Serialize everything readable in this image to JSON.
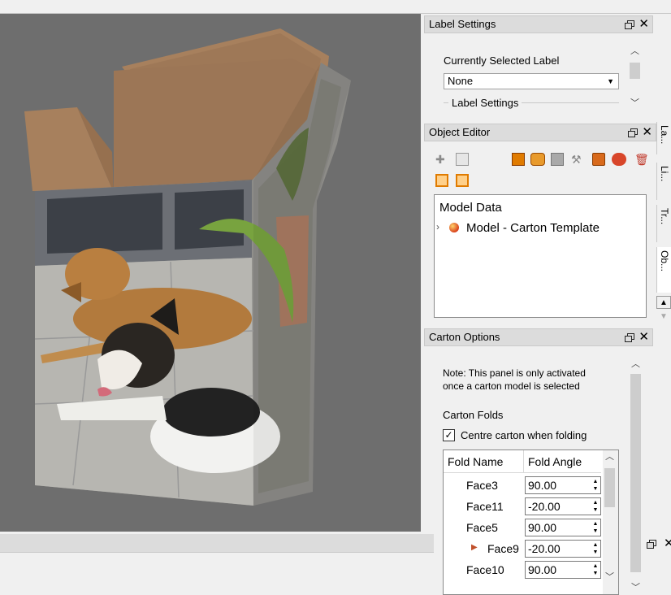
{
  "label_settings": {
    "title": "Label Settings",
    "currently_selected_label": "Currently Selected Label",
    "selected_value": "None",
    "group_title": "Label Settings"
  },
  "object_editor": {
    "title": "Object Editor",
    "tree_root": "Model Data",
    "tree_item": "Model - Carton Template"
  },
  "carton_options": {
    "title": "Carton Options",
    "note_line1": "Note: This panel is only activated",
    "note_line2": "once a carton model is selected",
    "folds_label": "Carton Folds",
    "centre_checkbox_label": "Centre carton when folding",
    "centre_checked": true,
    "columns": [
      "Fold Name",
      "Fold Angle"
    ],
    "rows": [
      {
        "name": "Face3",
        "angle": "90.00"
      },
      {
        "name": "Face11",
        "angle": "-20.00"
      },
      {
        "name": "Face5",
        "angle": "90.00"
      },
      {
        "name": "Face9",
        "angle": "-20.00"
      },
      {
        "name": "Face10",
        "angle": "90.00"
      }
    ]
  },
  "side_tabs": [
    "La...",
    "Li...",
    "Tr...",
    "Ob..."
  ],
  "icons": {
    "float": "float-window-icon",
    "close": "close-icon",
    "expand": "chevron-right-icon",
    "model": "model-sphere-icon"
  },
  "colors": {
    "viewport_bg": "#6e6e6e",
    "panel_title_bg": "#dcdcdc",
    "panel_bg": "#f0f0f0",
    "accent_orange": "#e07b00"
  }
}
